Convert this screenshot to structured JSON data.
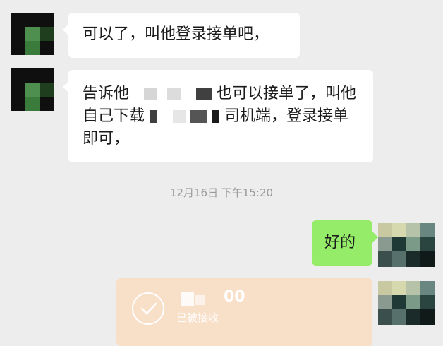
{
  "messages": [
    {
      "side": "left",
      "lines": [
        "可以了，叫他登录接单吧，"
      ]
    },
    {
      "side": "left",
      "lines": [
        "告诉他",
        "也可以接单了，叫他",
        "自己下载",
        "司机端，登录接单",
        "即可，"
      ]
    },
    {
      "side": "right",
      "text": "好的"
    }
  ],
  "timestamp": "12月16日 下午15:20",
  "transfer": {
    "amount_suffix": "00",
    "status": "已被接收"
  },
  "colors": {
    "background": "#ededed",
    "received_bubble": "#ffffff",
    "sent_bubble": "#95ec69",
    "transfer_card": "#f8dfc8"
  },
  "icons": [
    "avatar",
    "check-circle-icon"
  ]
}
